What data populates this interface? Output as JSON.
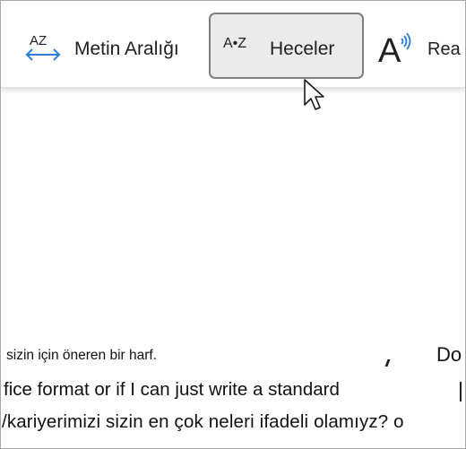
{
  "ribbon": {
    "text_spacing": {
      "icon_text": "AZ",
      "label": "Metin Aralığı",
      "icon": "text-spacing-icon"
    },
    "syllables": {
      "icon_text": "A•Z",
      "label": "Heceler",
      "icon": "syllables-icon"
    },
    "read_aloud": {
      "icon_text": "A",
      "label": "Rea",
      "icon": "read-aloud-icon"
    }
  },
  "document": {
    "line1": "sizin için öneren bir harf.",
    "line1_right": "Do",
    "line2": "fice format or if I can just write a standard",
    "line3": "/kariyerimizi sizin en çok neleri ifadeli olamıyz?  o"
  },
  "colors": {
    "accent_blue": "#2b7cd3",
    "selected_bg": "#ebebeb",
    "selected_border": "#7e7e7e"
  }
}
